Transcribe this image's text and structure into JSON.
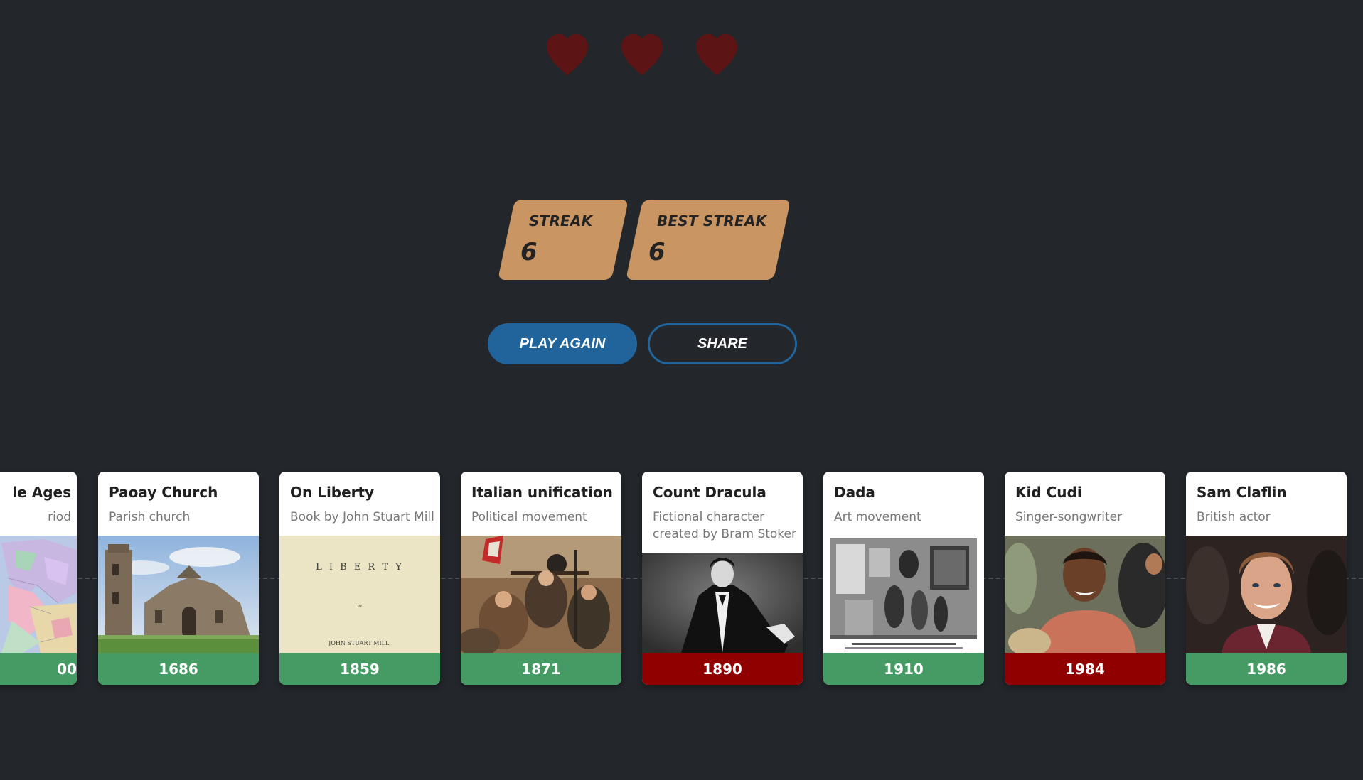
{
  "lives": {
    "hearts": [
      {
        "icon": "heart-icon",
        "state": "empty"
      },
      {
        "icon": "heart-icon",
        "state": "empty"
      },
      {
        "icon": "heart-icon",
        "state": "empty"
      }
    ],
    "heart_color": "#5c1414"
  },
  "scores": {
    "streak": {
      "label": "STREAK",
      "value": "6"
    },
    "best_streak": {
      "label": "BEST STREAK",
      "value": "6"
    },
    "panel_color": "#c99663"
  },
  "actions": {
    "play_again": "PLAY AGAIN",
    "share": "SHARE",
    "accent_color": "#21649b"
  },
  "timeline": {
    "cards": [
      {
        "title": "le Ages",
        "subtitle": "riod",
        "year": "00",
        "status": "correct",
        "image": "map-of-europe"
      },
      {
        "title": "Paoay Church",
        "subtitle": "Parish church",
        "year": "1686",
        "status": "correct",
        "image": "church-photo"
      },
      {
        "title": "On Liberty",
        "subtitle": "Book by John Stuart Mill",
        "year": "1859",
        "status": "correct",
        "image": "book-title-page"
      },
      {
        "title": "Italian unification",
        "subtitle": "Political movement",
        "year": "1871",
        "status": "correct",
        "image": "painting-riflemen"
      },
      {
        "title": "Count Dracula",
        "subtitle": "Fictional character created by Bram Stoker",
        "year": "1890",
        "status": "wrong",
        "image": "dracula-photo"
      },
      {
        "title": "Dada",
        "subtitle": "Art movement",
        "year": "1910",
        "status": "correct",
        "image": "dada-exhibition-photo"
      },
      {
        "title": "Kid Cudi",
        "subtitle": "Singer-songwriter",
        "year": "1984",
        "status": "wrong",
        "image": "kid-cudi-photo"
      },
      {
        "title": "Sam Claflin",
        "subtitle": "British actor",
        "year": "1986",
        "status": "correct",
        "image": "sam-claflin-photo"
      }
    ],
    "book_page": {
      "line1": "L I B E R T Y",
      "line2": "BY",
      "line3": "JOHN STUART MILL."
    },
    "colors": {
      "correct": "#459b63",
      "wrong": "#910000"
    }
  }
}
